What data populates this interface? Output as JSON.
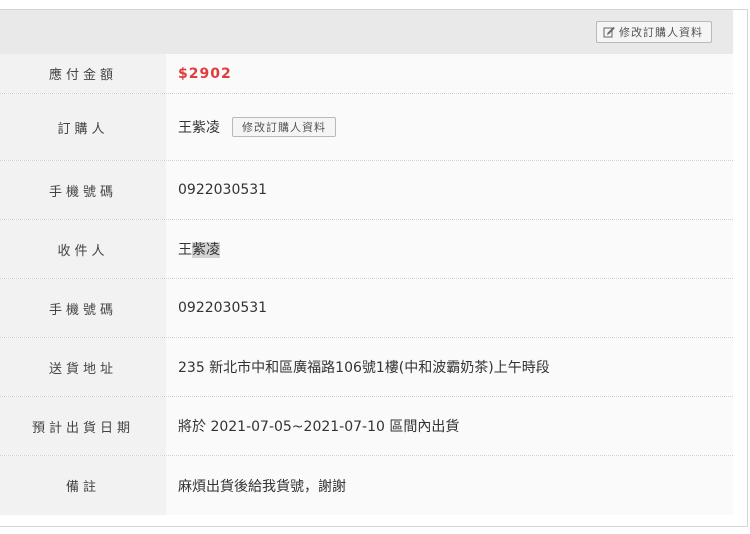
{
  "header": {
    "edit_buyer_button": "修改訂購人資料",
    "edit_icon": "pencil-square-icon"
  },
  "rows": [
    {
      "label": "應付金額",
      "value": "$2902"
    },
    {
      "label": "訂購人",
      "value": "王紫凌",
      "button": "修改訂購人資料"
    },
    {
      "label": "手機號碼",
      "value": "0922030531"
    },
    {
      "label": "收件人",
      "value_plain": "王",
      "value_selected": "紫凌"
    },
    {
      "label": "手機號碼",
      "value": "0922030531"
    },
    {
      "label": "送貨地址",
      "value": "235 新北市中和區廣福路106號1樓(中和波霸奶茶)上午時段"
    },
    {
      "label": "預計出貨日期",
      "value": "將於 2021-07-05~2021-07-10 區間內出貨"
    },
    {
      "label": "備註",
      "value": "麻煩出貨後給我貨號，謝謝"
    }
  ],
  "colors": {
    "amount": "#e03c3c",
    "label_bg": "#f2f2f2",
    "header_bg": "#e9e9e9"
  }
}
